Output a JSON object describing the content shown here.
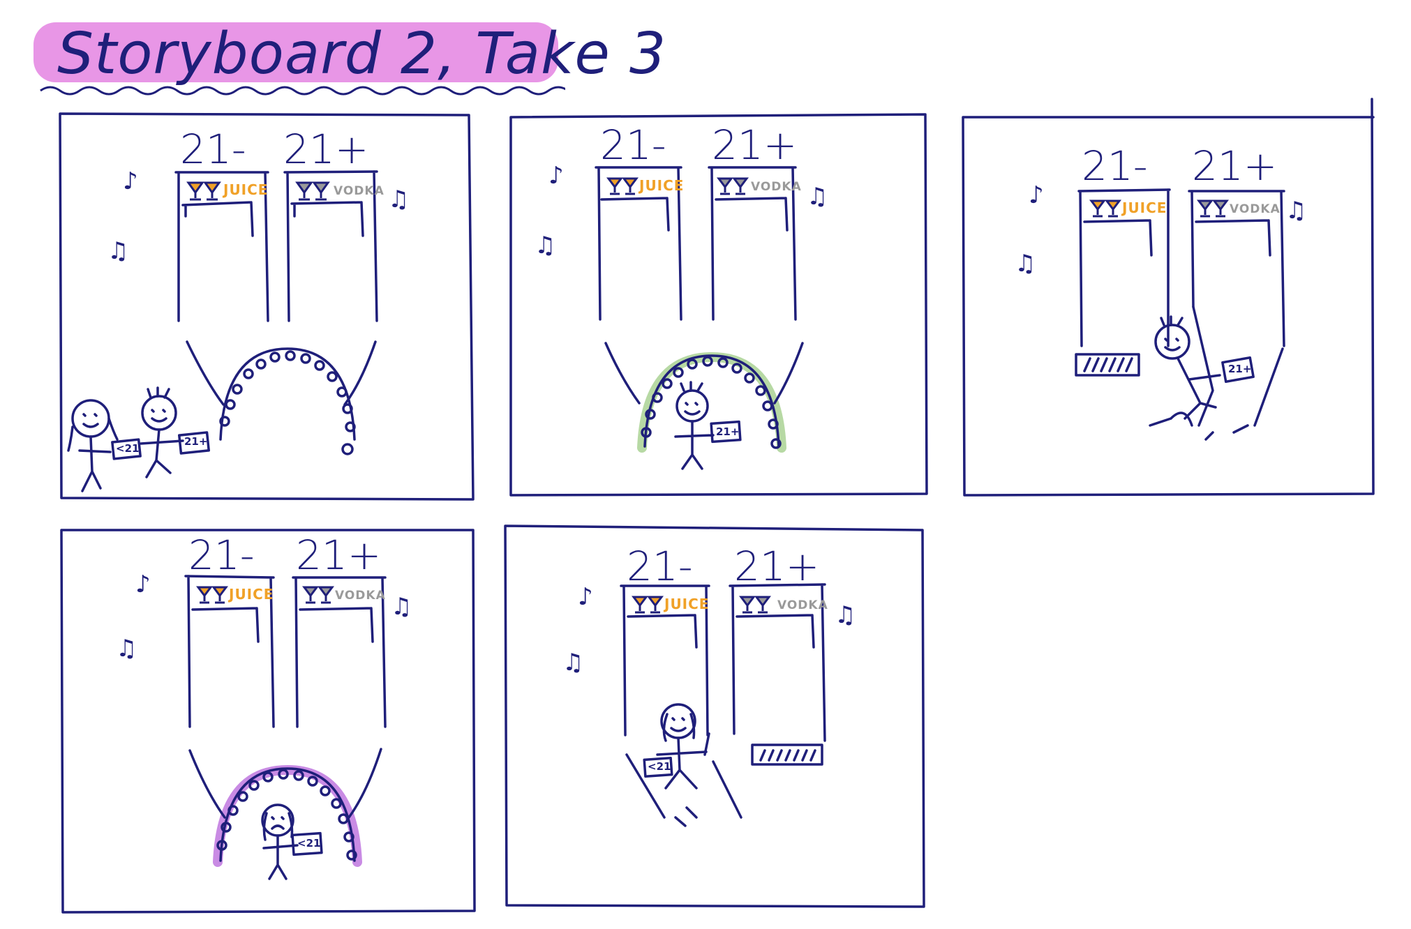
{
  "title": "Storyboard 2, Take 3",
  "colors": {
    "ink": "#1f1f7a",
    "title_highlight": "#e896e6",
    "juice": "#f0a128",
    "vodka": "#9a9a9a",
    "arch_green": "#b7d9a4",
    "arch_purple": "#c98be4"
  },
  "icons": [
    "eighth-note-icon",
    "beamed-notes-icon",
    "drink-glass-icon",
    "person-stick-figure-icon",
    "id-card-icon"
  ],
  "labels": {
    "under_21": "21-",
    "over_21": "21+",
    "juice": "JUICE",
    "vodka": "VODKA"
  },
  "panels": [
    {
      "id": 1,
      "cards": [
        "<21",
        "21+"
      ]
    },
    {
      "id": 2,
      "cards": [
        "21+"
      ]
    },
    {
      "id": 3,
      "cards": [
        "21+"
      ]
    },
    {
      "id": 4,
      "cards": [
        "<21"
      ]
    },
    {
      "id": 5,
      "cards": [
        "<21"
      ]
    }
  ]
}
